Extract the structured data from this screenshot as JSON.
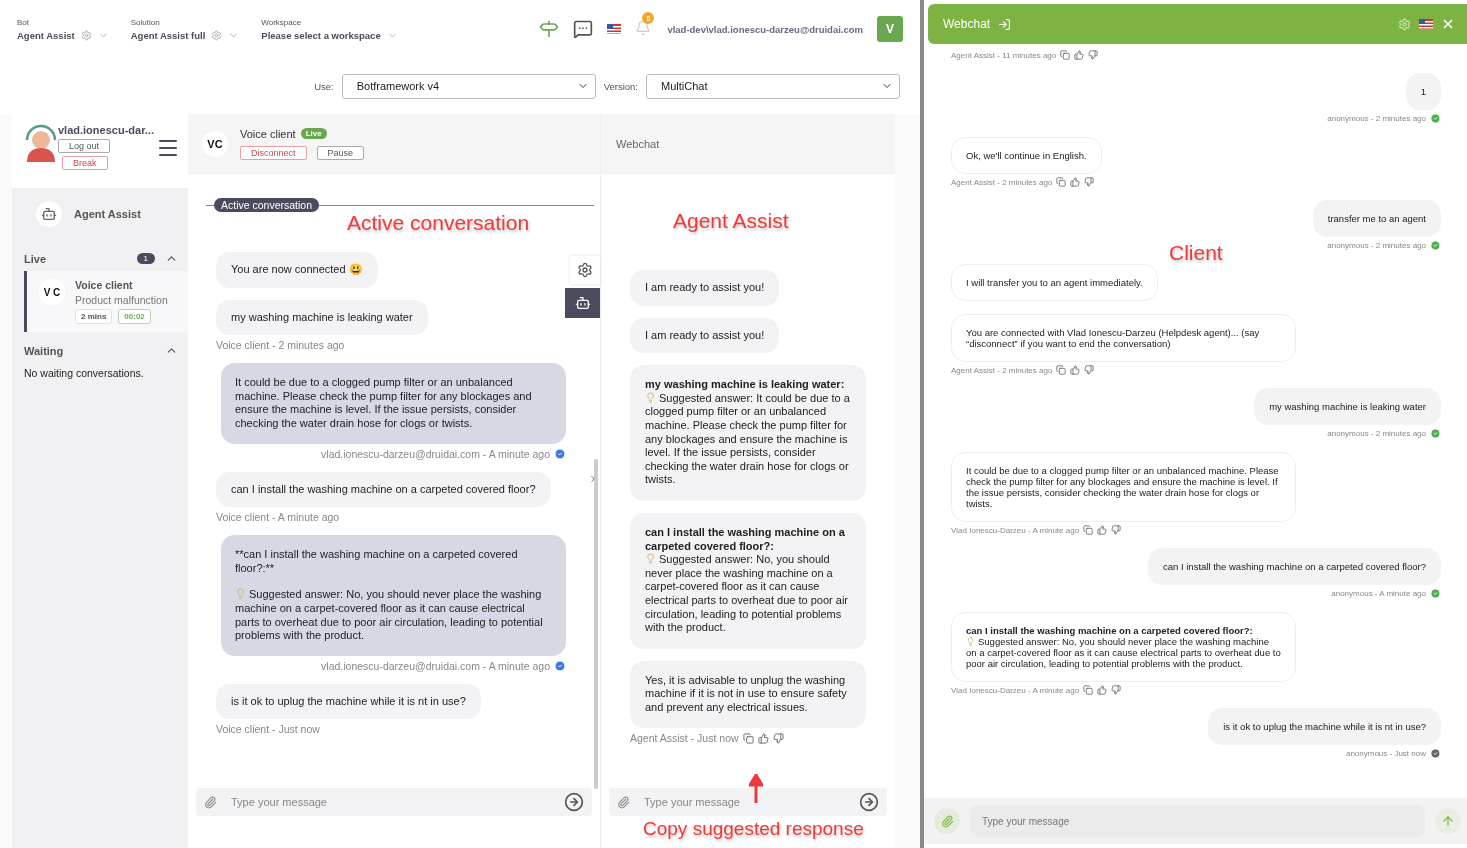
{
  "header": {
    "selectors": [
      {
        "label": "Bot",
        "value": "Agent Assist",
        "settings": true
      },
      {
        "label": "Solution",
        "value": "Agent Assist full",
        "settings": true
      },
      {
        "label": "Workspace",
        "value": "Please select a workspace",
        "settings": false
      }
    ],
    "notification_count": "5",
    "user": "vlad-dev\\vlad.ionescu-darzeu@druidai.com",
    "avatar": "V"
  },
  "config": {
    "use_label": "Use:",
    "use_value": "Botframework v4",
    "version_label": "Version:",
    "version_value": "MultiChat"
  },
  "sidebar": {
    "agent": {
      "name": "vlad.ionescu-dar...",
      "logout": "Log out",
      "break": "Break"
    },
    "bot": "Agent Assist",
    "sections": [
      {
        "title": "Live",
        "count": "1",
        "expanded": true,
        "conversations": [
          {
            "initials": "V C",
            "name": "Voice client",
            "topic": "Product malfunction",
            "duration": "2 mins",
            "timer": "00:02",
            "selected": true
          }
        ]
      },
      {
        "title": "Waiting",
        "expanded": true,
        "empty_text": "No waiting conversations."
      }
    ]
  },
  "conversation": {
    "initials": "VC",
    "name": "Voice client",
    "status": "Live",
    "actions": [
      "Disconnect",
      "Pause"
    ],
    "divider_label": "Active conversation",
    "messages": [
      {
        "kind": "client",
        "text": "You are now connected 😃"
      },
      {
        "kind": "client",
        "text": "my washing machine is leaking water",
        "meta": "Voice client - 2 minutes ago"
      },
      {
        "kind": "agent",
        "text": "It could be due to a clogged pump filter or an unbalanced machine. Please check the pump filter for any blockages and ensure the machine is level. If the issue persists, consider checking the water drain hose for clogs or twists.",
        "meta": "vlad.ionescu-darzeu@druidai.com - A minute ago"
      },
      {
        "kind": "client",
        "text": "can I install the washing machine on a carpeted covered floor?",
        "meta": "Voice client - A minute ago"
      },
      {
        "kind": "agent",
        "title": "**can I install the washing machine on a carpeted covered floor?:**",
        "answer": "Suggested answer: No, you should never place the washing machine on a carpet-covered floor as it can cause electrical parts to overheat due to poor air circulation, leading to potential problems with the product.",
        "meta": "vlad.ionescu-darzeu@druidai.com - A minute ago"
      },
      {
        "kind": "client",
        "text": "is it ok to uplug the machine while it is nt in use?",
        "meta": "Voice client - Just now"
      }
    ],
    "input_placeholder": "Type your message"
  },
  "assist": {
    "title": "Webchat",
    "messages": [
      {
        "text": "I am ready to assist you!"
      },
      {
        "text": "I am ready to assist you!"
      },
      {
        "title": "my washing machine is leaking water:",
        "answer": "Suggested answer: It could be due to a clogged pump filter or an unbalanced machine. Please check the pump filter for any blockages and ensure the machine is level. If the issue persists, consider checking the water drain hose for clogs or twists."
      },
      {
        "title": "can I install the washing machine on a carpeted covered floor?:",
        "answer": "Suggested answer: No, you should never place the washing machine on a carpet-covered floor as it can cause electrical parts to overheat due to poor air circulation, leading to potential problems with the product."
      },
      {
        "text": "Yes, it is advisable to unplug the washing machine if it is not in use to ensure safety and prevent any electrical issues.",
        "meta": "Agent Assist - Just now"
      }
    ],
    "input_placeholder": "Type your message"
  },
  "webchat": {
    "title": "Webchat",
    "messages": [
      {
        "kind": "bot",
        "meta": "Agent Assist - 11 minutes ago"
      },
      {
        "kind": "user",
        "text": "1",
        "meta": "anonymous - 2 minutes ago",
        "seen": true
      },
      {
        "kind": "bot",
        "text": "Ok, we'll continue in English.",
        "meta": "Agent Assist - 2 minutes ago"
      },
      {
        "kind": "user",
        "text": "transfer me to an agent",
        "meta": "anonymous - 2 minutes ago",
        "seen": true
      },
      {
        "kind": "bot",
        "text": "I will transfer you to an agent immediately."
      },
      {
        "kind": "bot",
        "text": "You are connected with Vlad Ionescu-Darzeu (Helpdesk agent)... (say “disconnect” if you want to end the conversation)",
        "meta": "Agent Assist - 2 minutes ago"
      },
      {
        "kind": "user",
        "text": "my washing machine is leaking water",
        "meta": "anonymous - 2 minutes ago",
        "seen": true
      },
      {
        "kind": "bot",
        "text": "It could be due to a clogged pump filter or an unbalanced machine. Please check the pump filter for any blockages and ensure the machine is level. If the issue persists, consider checking the water drain hose for clogs or twists.",
        "meta": "Vlad Ionescu-Darzeu - A minute ago"
      },
      {
        "kind": "user",
        "text": "can I install the washing machine on a carpeted covered floor?",
        "meta": "anonymous - A minute ago",
        "seen": true
      },
      {
        "kind": "bot",
        "title": "can I install the washing machine on a carpeted covered floor?:",
        "answer": "Suggested answer: No, you should never place the washing machine on a carpet-covered floor as it can cause electrical parts to overheat due to poor air circulation, leading to potential problems with the product.",
        "meta": "Vlad Ionescu-Darzeu - A minute ago"
      },
      {
        "kind": "user",
        "text": "is it ok to uplug the machine while it is nt in use?",
        "meta": "anonymous - Just now",
        "seen": false
      }
    ],
    "input_placeholder": "Type your message"
  },
  "annotations": [
    {
      "text": "Active conversation",
      "arrow": false
    },
    {
      "text": "Agent Assist",
      "arrow": false
    },
    {
      "text": "Client",
      "arrow": false
    },
    {
      "text": "Copy suggested response",
      "arrow": true
    }
  ]
}
